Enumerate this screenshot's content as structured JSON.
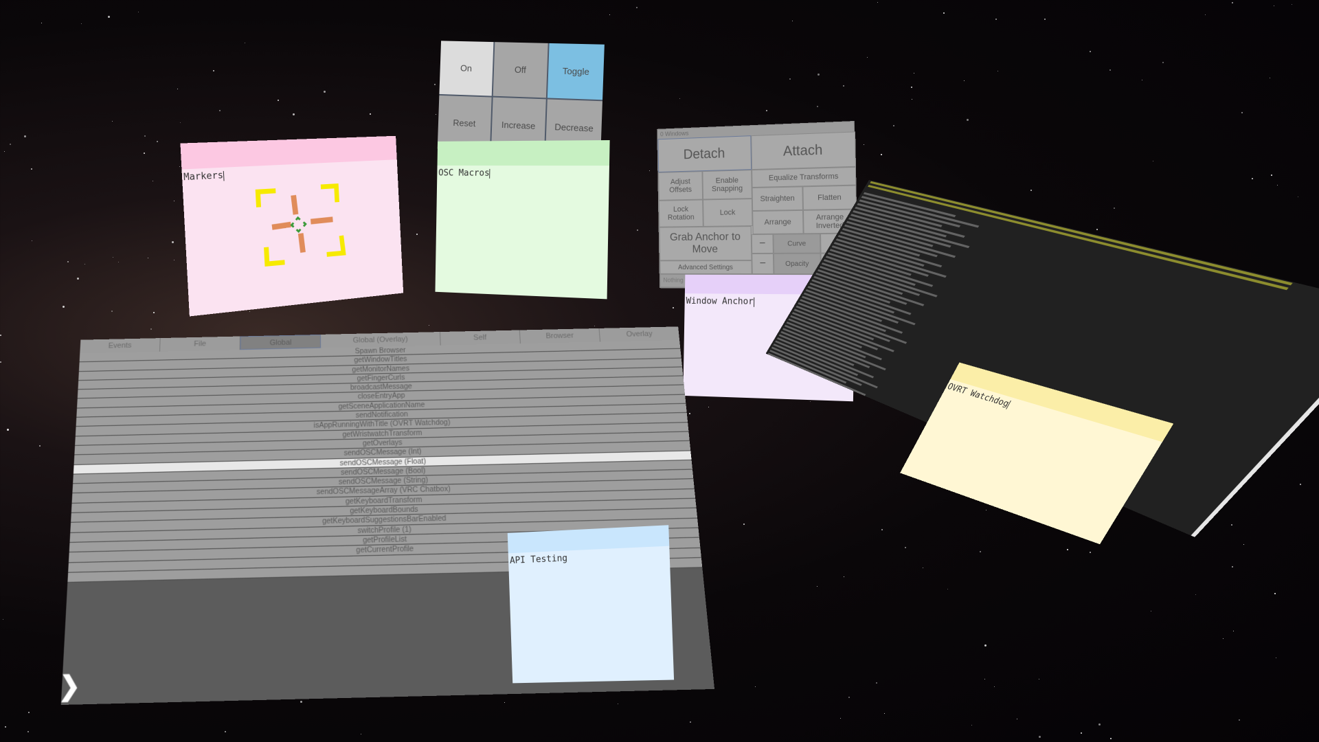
{
  "toggle_grid": {
    "buttons": [
      "On",
      "Off",
      "Toggle",
      "Reset",
      "Increase",
      "Decrease"
    ]
  },
  "notes": {
    "markers": "Markers",
    "osc_macros": "OSC Macros",
    "window_anchor": "Window Anchor",
    "api_testing": "API Testing",
    "ovrt_watchdog": "OVRT Watchdog"
  },
  "windows_panel": {
    "header": "0 Windows",
    "detach": "Detach",
    "attach": "Attach",
    "adjust_offsets": "Adjust Offsets",
    "enable_snapping": "Enable Snapping",
    "equalize_transforms": "Equalize Transforms",
    "straighten": "Straighten",
    "flatten": "Flatten",
    "lock_rotation": "Lock Rotation",
    "lock": "Lock",
    "arrange": "Arrange",
    "arrange_inverted": "Arrange Inverted",
    "grab_anchor": "Grab Anchor to Move",
    "curve_minus": "−",
    "curve_label": "Curve",
    "curve_plus": "+",
    "opacity_minus": "−",
    "opacity_label": "Opacity",
    "opacity_plus": "+",
    "advanced_settings": "Advanced Settings",
    "status": "Nothing to"
  },
  "api_panel": {
    "tabs": [
      "Events",
      "File",
      "Global",
      "Global (Overlay)",
      "Self",
      "Browser",
      "Overlay"
    ],
    "active_tab": "Global",
    "items": [
      "Spawn Browser",
      "getWindowTitles",
      "getMonitorNames",
      "getFingerCurls",
      "broadcastMessage",
      "closeEntryApp",
      "getSceneApplicationName",
      "sendNotification",
      "isAppRunningWithTitle (OVRT Watchdog)",
      "getWristwatchTransform",
      "getOverlays",
      "sendOSCMessage (Int)",
      "sendOSCMessage (Float)",
      "sendOSCMessage (Bool)",
      "sendOSCMessage (String)",
      "sendOSCMessageArray (VRC Chatbox)",
      "getKeyboardTransform",
      "getKeyboardBounds",
      "getKeyboardSuggestionsBarEnabled",
      "switchProfile (1)",
      "getProfileList",
      "getCurrentProfile"
    ],
    "selected_item": "sendOSCMessage (Float)",
    "next_icon": "chevron-right-icon"
  },
  "log_panel": {
    "warn_color": "#e8e83a",
    "line_count": 60
  }
}
